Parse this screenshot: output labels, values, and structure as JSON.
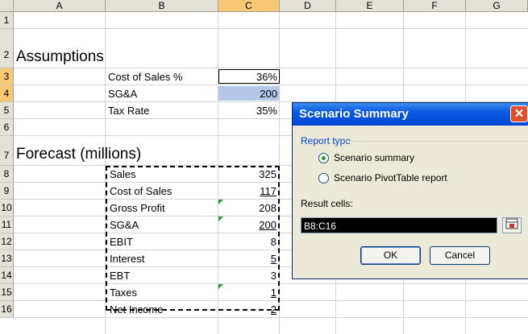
{
  "columns": [
    "A",
    "B",
    "C",
    "D",
    "E",
    "F",
    "G"
  ],
  "rows": [
    "1",
    "2",
    "3",
    "4",
    "5",
    "6",
    "7",
    "8",
    "9",
    "10",
    "11",
    "12",
    "13",
    "14",
    "15",
    "16"
  ],
  "assumptions": {
    "title": "Assumptions",
    "items": [
      {
        "label": "Cost of Sales %",
        "value": "36%"
      },
      {
        "label": "SG&A",
        "value": "200"
      },
      {
        "label": "Tax Rate",
        "value": "35%"
      }
    ]
  },
  "forecast": {
    "title": "Forecast (millions)",
    "items": [
      {
        "label": "Sales",
        "value": "325"
      },
      {
        "label": "Cost of Sales",
        "value": "117"
      },
      {
        "label": "Gross Profit",
        "value": "208"
      },
      {
        "label": "SG&A",
        "value": "200"
      },
      {
        "label": "EBIT",
        "value": "8"
      },
      {
        "label": "Interest",
        "value": "5"
      },
      {
        "label": "EBT",
        "value": "3"
      },
      {
        "label": "Taxes",
        "value": "1"
      },
      {
        "label": "Net Income",
        "value": "2"
      }
    ]
  },
  "dialog": {
    "title": "Scenario Summary",
    "close_icon": "close-icon",
    "report_type_label": "Report type",
    "options": [
      {
        "label": "Scenario summary",
        "selected": true
      },
      {
        "label": "Scenario PivotTable report",
        "selected": false
      }
    ],
    "result_label": "Result cells:",
    "result_value": "B8:C16",
    "ok_label": "OK",
    "cancel_label": "Cancel"
  },
  "colors": {
    "selected_header": "#f8c874",
    "titlebar": "#0a5ae0",
    "selected_cell": "#b3c8e8"
  }
}
